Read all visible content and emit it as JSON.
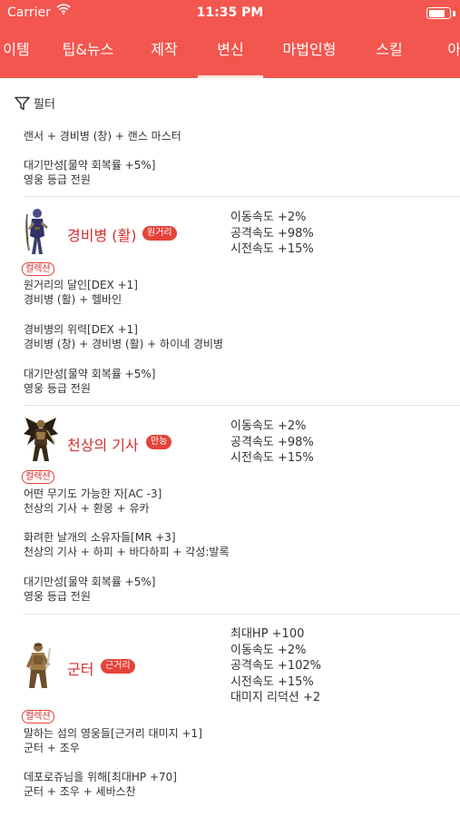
{
  "status_bar": {
    "carrier": "Carrier",
    "time": "11:35 PM",
    "battery_level": 0.85
  },
  "tabs": [
    "이템",
    "팁&뉴스",
    "제작",
    "변신",
    "마법인형",
    "스킬",
    "아이"
  ],
  "active_tab": "변신",
  "filter_label": "필터",
  "top_entry": {
    "recipe": "랜서 + 경비병 (창) + 랜스 마스터",
    "bonus_name": "대기만성[물약 회복률 +5%]",
    "bonus_note": "영웅 등급 전원"
  },
  "cards": [
    {
      "name": "경비병 (활)",
      "badge": "원거리",
      "stats": [
        "이동속도 +2%",
        "공격속도 +98%",
        "시전속도 +15%"
      ],
      "collection_label": "컬렉션",
      "collections": [
        {
          "title": "원거리의 달인[DEX +1]",
          "recipe": "경비병 (활) + 헬바인"
        },
        {
          "title": "경비병의 위력[DEX +1]",
          "recipe": "경비병 (창) + 경비병 (활) + 하이네 경비병"
        },
        {
          "title": "대기만성[물약 회복률 +5%]",
          "recipe": "영웅 등급 전원"
        }
      ]
    },
    {
      "name": "천상의 기사",
      "badge": "만능",
      "stats": [
        "이동속도 +2%",
        "공격속도 +98%",
        "시전속도 +15%"
      ],
      "collection_label": "컬렉션",
      "collections": [
        {
          "title": "어떤 무기도 가능한 자[AC -3]",
          "recipe": "천상의 기사 + 환몽 + 유카"
        },
        {
          "title": "화려한 날개의 소유자들[MR +3]",
          "recipe": "천상의 기사 + 하피 + 바다하피 + 각성:발록"
        },
        {
          "title": "대기만성[물약 회복률 +5%]",
          "recipe": "영웅 등급 전원"
        }
      ]
    },
    {
      "name": "군터",
      "badge": "근거리",
      "stats": [
        "최대HP +100",
        "이동속도 +2%",
        "공격속도 +102%",
        "시전속도 +15%",
        "대미지 리덕션 +2"
      ],
      "collection_label": "컬렉션",
      "collections": [
        {
          "title": "말하는 섬의 영웅들[근거리 대미지 +1]",
          "recipe": "군터 + 조우"
        },
        {
          "title": "데포로쥬님을 위해[최대HP +70]",
          "recipe": "군터 + 조우 + 세바스찬"
        }
      ]
    }
  ]
}
